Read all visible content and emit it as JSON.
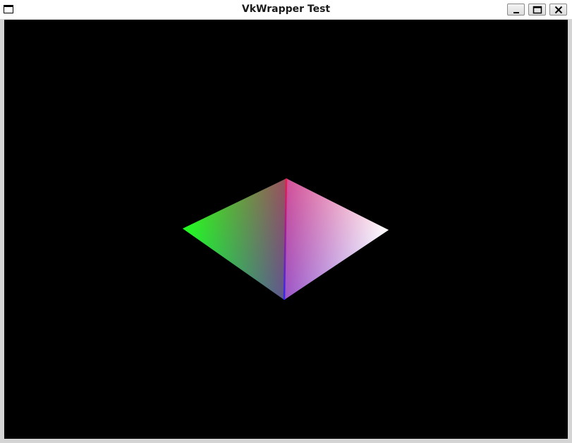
{
  "window": {
    "title": "VkWrapper Test"
  },
  "titlebar_buttons": {
    "minimize_icon": "minimize-icon",
    "maximize_icon": "maximize-icon",
    "close_icon": "close-icon"
  },
  "colors": {
    "viewport_background": "#000000",
    "vertex_top": "#ff1040",
    "vertex_left": "#20ff20",
    "vertex_right": "#ffffff",
    "vertex_bottom": "#2020ff"
  }
}
